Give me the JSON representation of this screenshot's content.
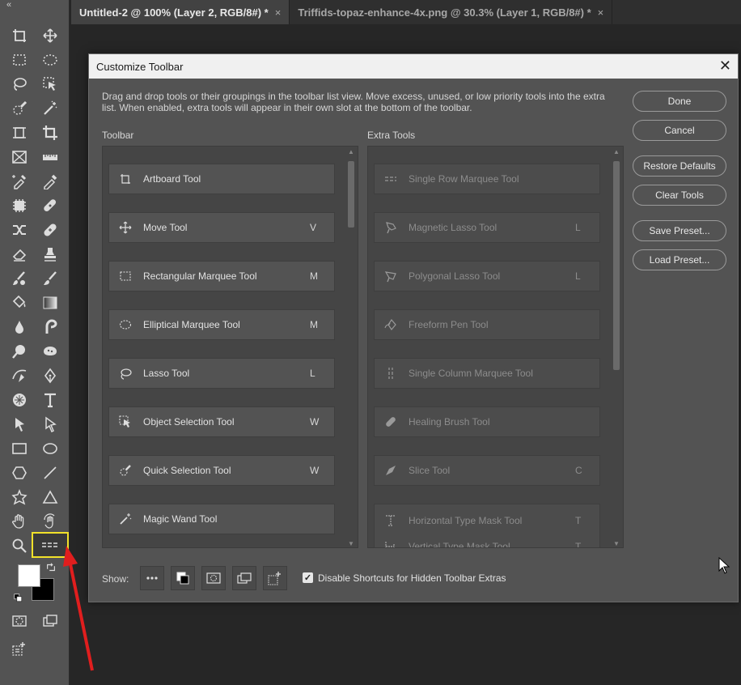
{
  "document_tabs": [
    {
      "label": "Untitled-2 @ 100% (Layer 2, RGB/8#) *",
      "close": "×"
    },
    {
      "label": "Triffids-topaz-enhance-4x.png @ 30.3% (Layer 1, RGB/8#) *",
      "close": "×"
    }
  ],
  "toolbar": {
    "collapse": "«"
  },
  "dialog": {
    "title": "Customize Toolbar",
    "close": "✕",
    "description": "Drag and drop tools or their groupings in the toolbar list view. Move excess, unused, or low priority tools into the extra list. When enabled, extra tools will appear in their own slot at the bottom of the toolbar.",
    "toolbar_label": "Toolbar",
    "extra_label": "Extra Tools",
    "toolbar_items": [
      {
        "name": "Artboard Tool",
        "shortcut": ""
      },
      {
        "name": "Move Tool",
        "shortcut": "V"
      },
      {
        "name": "Rectangular Marquee Tool",
        "shortcut": "M"
      },
      {
        "name": "Elliptical Marquee Tool",
        "shortcut": "M"
      },
      {
        "name": "Lasso Tool",
        "shortcut": "L"
      },
      {
        "name": "Object Selection Tool",
        "shortcut": "W"
      },
      {
        "name": "Quick Selection Tool",
        "shortcut": "W"
      },
      {
        "name": "Magic Wand Tool",
        "shortcut": ""
      }
    ],
    "extra_items": [
      {
        "name": "Single Row Marquee Tool",
        "shortcut": ""
      },
      {
        "name": "Magnetic Lasso Tool",
        "shortcut": "L"
      },
      {
        "name": "Polygonal Lasso Tool",
        "shortcut": "L"
      },
      {
        "name": "Freeform Pen Tool",
        "shortcut": ""
      },
      {
        "name": "Single Column Marquee Tool",
        "shortcut": ""
      },
      {
        "name": "Healing Brush Tool",
        "shortcut": ""
      },
      {
        "name": "Slice Tool",
        "shortcut": "C"
      },
      {
        "name": "Horizontal Type Mask Tool",
        "shortcut": "T"
      },
      {
        "name": "Vertical Type Mask Tool",
        "shortcut": "T"
      }
    ],
    "buttons": {
      "done": "Done",
      "cancel": "Cancel",
      "restore": "Restore Defaults",
      "clear": "Clear Tools",
      "save_preset": "Save Preset...",
      "load_preset": "Load Preset..."
    },
    "show_label": "Show:",
    "checkbox_label": "Disable Shortcuts for Hidden Toolbar Extras",
    "checkbox_checked": true
  },
  "colors": {
    "highlight": "#f1e12a",
    "arrow": "#e01e1e"
  }
}
